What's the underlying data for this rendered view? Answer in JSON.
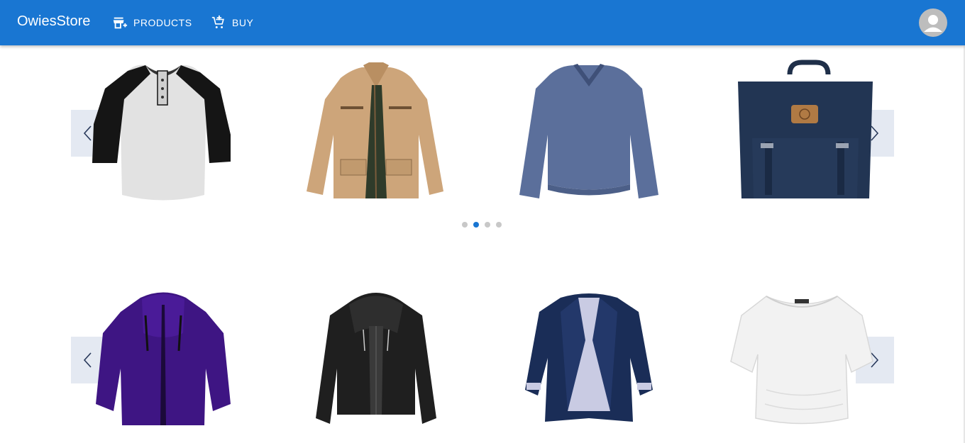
{
  "app": {
    "title": "OwiesStore",
    "nav": [
      {
        "label": "PRODUCTS",
        "icon": "store-add-icon"
      },
      {
        "label": "BUY",
        "icon": "cart-add-icon"
      }
    ],
    "account_icon": "account-circle-icon"
  },
  "colors": {
    "appbar": "#1976d2",
    "arrow_bg": "#e4e9f2",
    "dot_active": "#1976d2",
    "dot_inactive": "#c8c8c8"
  },
  "carousels": [
    {
      "products": [
        "raglan-henley-tshirt",
        "khaki-field-jacket",
        "blue-vneck-sweater",
        "navy-backpack"
      ],
      "dots": 4,
      "active_dot": 2
    },
    {
      "products": [
        "purple-hooded-jacket",
        "black-leather-hooded-jacket",
        "navy-trench-jacket",
        "white-dolman-top"
      ]
    }
  ]
}
